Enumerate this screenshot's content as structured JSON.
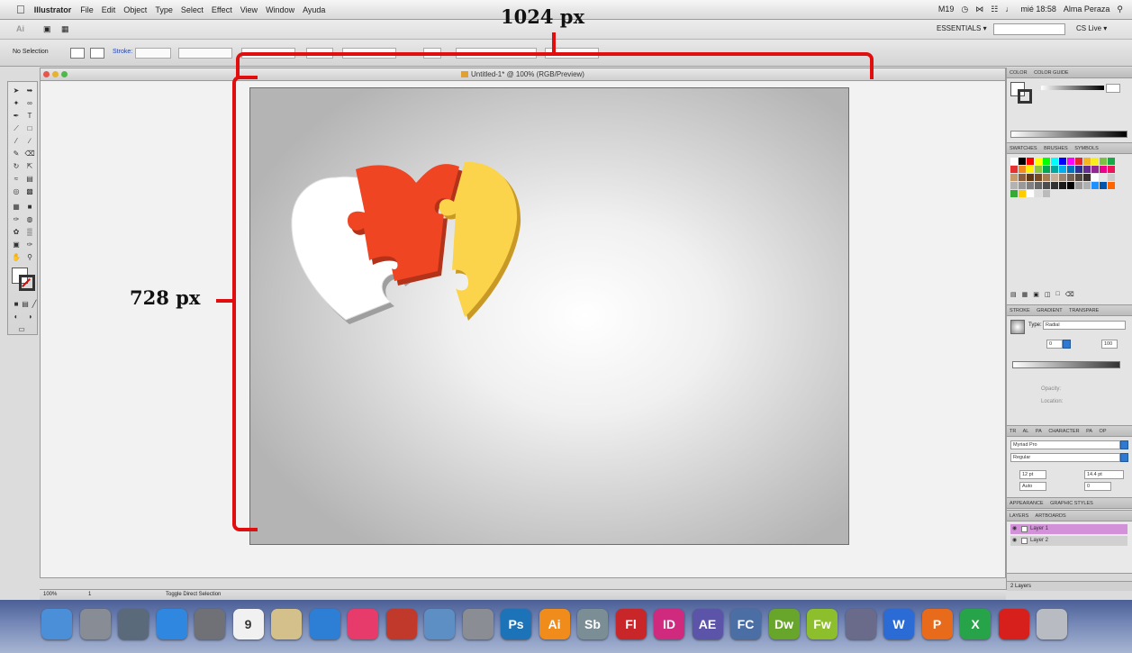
{
  "menubar": {
    "app_name": "Illustrator",
    "menus": [
      "File",
      "Edit",
      "Object",
      "Type",
      "Select",
      "Effect",
      "View",
      "Window",
      "Ayuda"
    ],
    "status_right": {
      "battery_app": "M19",
      "clock": "mié 18:58",
      "user": "Alma Peraza"
    }
  },
  "app_bar": {
    "logo": "Ai",
    "workspace_label": "ESSENTIALS ▾",
    "search_placeholder": "",
    "cs_live_label": "CS Live ▾"
  },
  "control_panel": {
    "selection_label": "No Selection",
    "stroke_label": "Stroke:"
  },
  "document": {
    "tab_title": "Untitled-1* @ 100% (RGB/Preview)"
  },
  "annotations": {
    "width_label": "1024 px",
    "height_label": "728 px",
    "bracket_color": "#e00e0e"
  },
  "puzzle": {
    "pieces": [
      {
        "name": "white",
        "color": "#ffffff"
      },
      {
        "name": "red",
        "color": "#ef4523"
      },
      {
        "name": "yellow",
        "color": "#fbd44b"
      }
    ]
  },
  "panels": {
    "color_tabs": [
      "COLOR",
      "COLOR GUIDE"
    ],
    "swatch_tabs": [
      "SWATCHES",
      "BRUSHES",
      "SYMBOLS"
    ],
    "gradient_tabs": [
      "STROKE",
      "GRADIENT",
      "TRANSPARE"
    ],
    "gradient_type_label": "Type:",
    "gradient_type_value": "Radial",
    "gradient_angle": "0",
    "gradient_ratio": "100",
    "gradient_opacity_label": "Opacity:",
    "gradient_location_label": "Location:",
    "character_tabs": [
      "TR",
      "AL",
      "PA",
      "CHARACTER",
      "PA",
      "OP"
    ],
    "font_family": "Myriad Pro",
    "font_style": "Regular",
    "font_size": "12 pt",
    "leading": "14.4 pt",
    "kerning": "Auto",
    "tracking": "0",
    "appearance_tabs": [
      "APPEARANCE",
      "GRAPHIC STYLES"
    ],
    "layers_tabs": [
      "LAYERS",
      "ARTBOARDS"
    ],
    "layers": [
      {
        "name": "Layer 1",
        "color": "#d291d8"
      },
      {
        "name": "Layer 2",
        "color": "#d0d0d0"
      }
    ],
    "layers_count": "2 Layers",
    "swatch_colors": [
      "#ffffff",
      "#000000",
      "#ff0000",
      "#ffff00",
      "#00ff00",
      "#00ffff",
      "#0000ff",
      "#ff00ff",
      "#e8262b",
      "#f7b61d",
      "#f9ec1c",
      "#7ec043",
      "#17a84a",
      "#e5312f",
      "#f28b1f",
      "#fff100",
      "#8dc63f",
      "#00a651",
      "#00a99d",
      "#00aeef",
      "#0072bc",
      "#2e3192",
      "#662d91",
      "#92278f",
      "#ec008c",
      "#ed145b",
      "#c69c6d",
      "#8b5e3c",
      "#603913",
      "#754c24",
      "#a67c52",
      "#c7b299",
      "#998675",
      "#736357",
      "#534741",
      "#362f2d",
      "#ffffff",
      "#e6e6e6",
      "#cccccc",
      "#b3b3b3",
      "#999999",
      "#808080",
      "#666666",
      "#4d4d4d",
      "#333333",
      "#1a1a1a",
      "#000000",
      "#9b9b9b",
      "#b0b0b0",
      "#1e90ff",
      "#0055aa",
      "#ff6600",
      "#33aa33",
      "#ffcc00",
      "#ffffff",
      "#dddddd",
      "#bbbbbb"
    ]
  },
  "status_bar": {
    "zoom": "100%",
    "page": "1",
    "tool_hint": "Toggle Direct Selection"
  },
  "dock": {
    "apps": [
      {
        "name": "Finder",
        "label": "",
        "color": "#4a8fd8"
      },
      {
        "name": "Launchpad",
        "label": "",
        "color": "#888c94"
      },
      {
        "name": "Mission Control",
        "label": "",
        "color": "#5a6a7a"
      },
      {
        "name": "App Store",
        "label": "",
        "color": "#2f87e0"
      },
      {
        "name": "FaceTime",
        "label": "",
        "color": "#6f7177"
      },
      {
        "name": "Calendar",
        "label": "9",
        "color": "#f1f1f1"
      },
      {
        "name": "Stickies",
        "label": "",
        "color": "#d4c08a"
      },
      {
        "name": "Safari",
        "label": "",
        "color": "#2d7fd6"
      },
      {
        "name": "iTunes",
        "label": "",
        "color": "#e73b6b"
      },
      {
        "name": "Photo Booth",
        "label": "",
        "color": "#c0392b"
      },
      {
        "name": "iPhoto",
        "label": "",
        "color": "#5d8fc4"
      },
      {
        "name": "System Preferences",
        "label": "",
        "color": "#8a8d93"
      },
      {
        "name": "Photoshop",
        "label": "Ps",
        "color": "#1c73b8"
      },
      {
        "name": "Illustrator",
        "label": "Ai",
        "color": "#f08c1c"
      },
      {
        "name": "Soundbooth",
        "label": "Sb",
        "color": "#7c8e95"
      },
      {
        "name": "Flash",
        "label": "Fl",
        "color": "#c9262a"
      },
      {
        "name": "InDesign",
        "label": "ID",
        "color": "#cf2a7e"
      },
      {
        "name": "After Effects",
        "label": "AE",
        "color": "#5b54a8"
      },
      {
        "name": "Flash Catalyst",
        "label": "FC",
        "color": "#4b6fa5"
      },
      {
        "name": "Dreamweaver",
        "label": "Dw",
        "color": "#68a52b"
      },
      {
        "name": "Fireworks",
        "label": "Fw",
        "color": "#8dbe2c"
      },
      {
        "name": "Save",
        "label": "",
        "color": "#6a6a8a"
      },
      {
        "name": "Word",
        "label": "W",
        "color": "#2b6bd6"
      },
      {
        "name": "PowerPoint",
        "label": "P",
        "color": "#e86b1c"
      },
      {
        "name": "Excel",
        "label": "X",
        "color": "#27a34a"
      },
      {
        "name": "Acrobat",
        "label": "",
        "color": "#d7201c"
      },
      {
        "name": "Trash",
        "label": "",
        "color": "#b8bcc2"
      }
    ]
  }
}
